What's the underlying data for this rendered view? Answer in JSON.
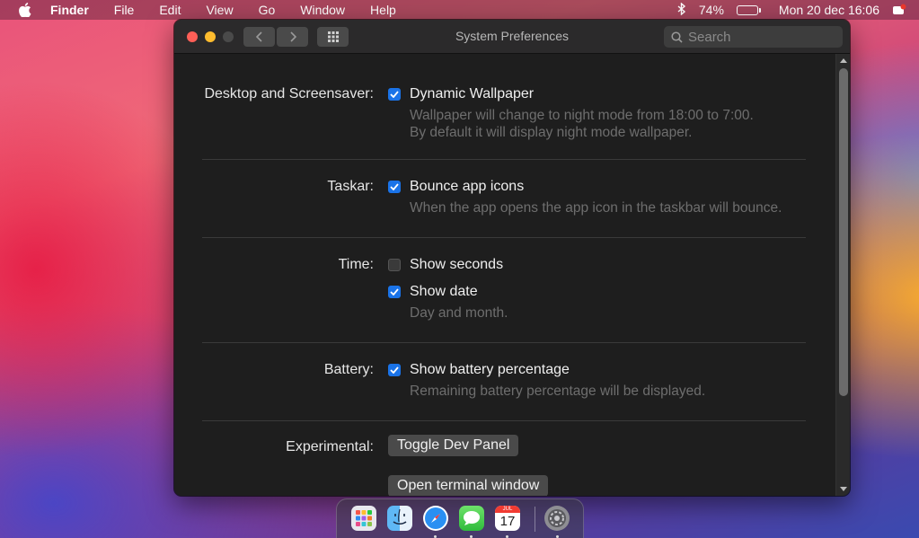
{
  "menubar": {
    "app_name": "Finder",
    "items": [
      "File",
      "Edit",
      "View",
      "Go",
      "Window",
      "Help"
    ],
    "battery_percent": "74%",
    "battery_level": 0.74,
    "datetime": "Mon 20 dec 16:06"
  },
  "window": {
    "title": "System Preferences",
    "search_placeholder": "Search"
  },
  "sections": {
    "desktop": {
      "label": "Desktop and Screensaver:",
      "option": "Dynamic Wallpaper",
      "checked": true,
      "desc_line1": "Wallpaper will change to night mode from 18:00 to 7:00.",
      "desc_line2": "By default it will display night mode wallpaper."
    },
    "taskbar": {
      "label": "Taskar:",
      "option": "Bounce app icons",
      "checked": true,
      "desc": "When the app opens the app icon in the taskbar will bounce."
    },
    "time": {
      "label": "Time:",
      "option1": "Show seconds",
      "option1_checked": false,
      "option2": "Show date",
      "option2_checked": true,
      "desc": "Day and month."
    },
    "battery": {
      "label": "Battery:",
      "option": "Show battery percentage",
      "checked": true,
      "desc": "Remaining battery percentage will be displayed."
    },
    "experimental": {
      "label": "Experimental:",
      "button1": "Toggle Dev Panel",
      "button2": "Open terminal window"
    }
  },
  "dock": {
    "apps": [
      "launchpad-icon",
      "finder-icon",
      "safari-icon",
      "messages-icon",
      "calendar-icon",
      "system-preferences-icon"
    ],
    "calendar_month": "JUL",
    "calendar_day": "17"
  },
  "colors": {
    "accent": "#1a73e8",
    "window_bg": "#1e1e1e",
    "close": "#fe5f57",
    "minimize": "#febc2e"
  }
}
